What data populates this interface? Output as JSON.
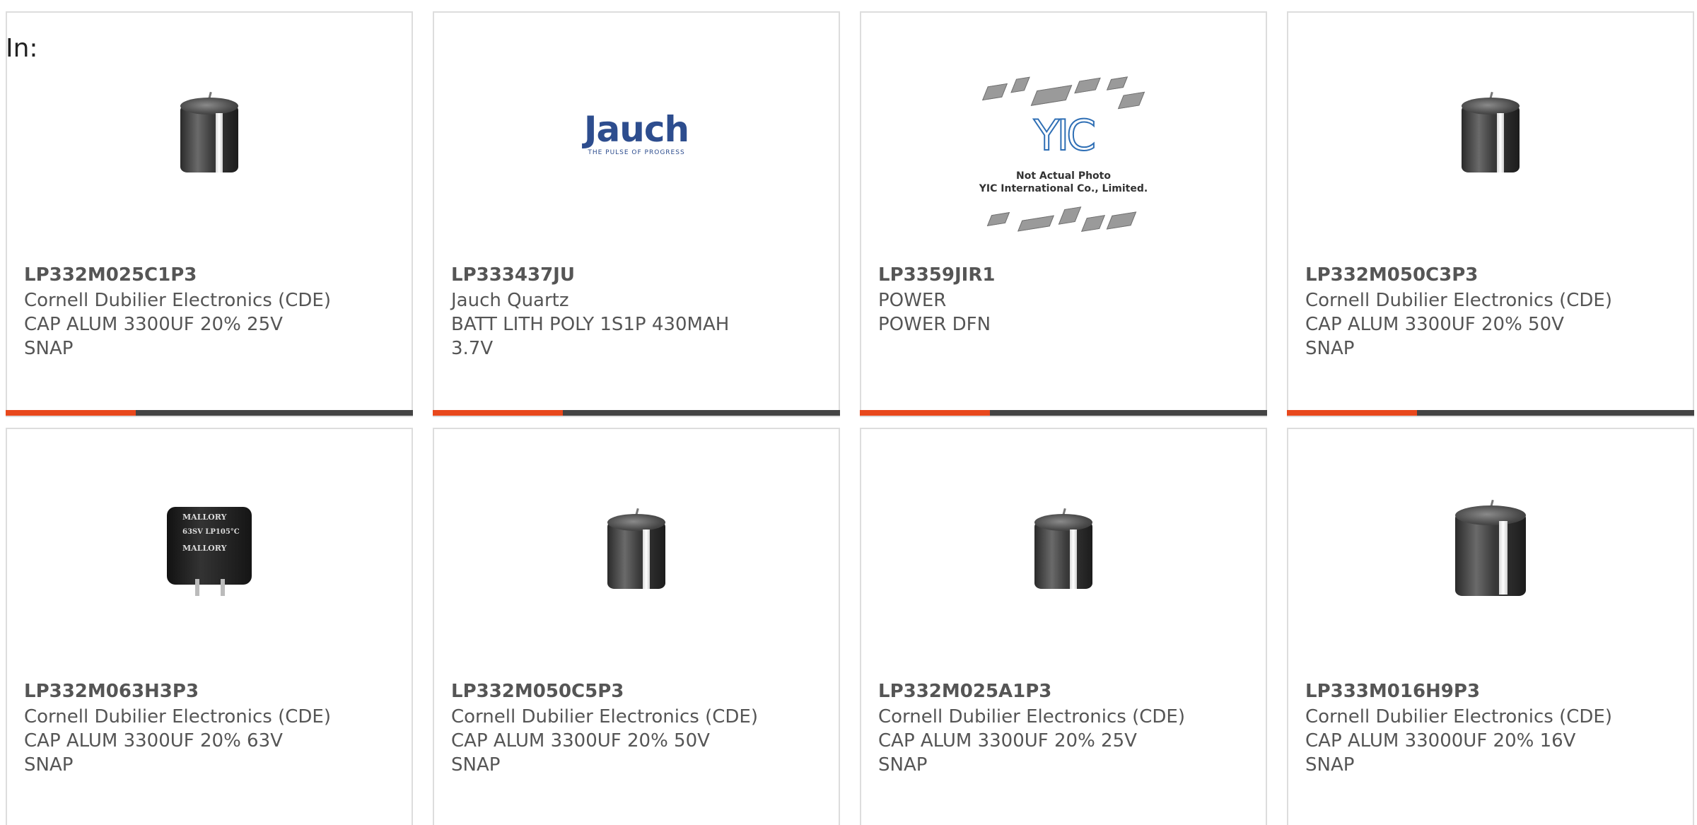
{
  "filter": {
    "label": "In:"
  },
  "products": [
    {
      "part": "LP332M025C1P3",
      "manufacturer": "Cornell Dubilier Electronics (CDE)",
      "description": "CAP ALUM 3300UF 20% 25V\nSNAP",
      "image": "capacitor-image",
      "progress": 0.32
    },
    {
      "part": "LP333437JU",
      "manufacturer": "Jauch Quartz",
      "description": "BATT LITH POLY 1S1P 430MAH\n3.7V",
      "image": "jauch-logo",
      "logo_text": "Jauch",
      "logo_tagline": "THE PULSE OF PROGRESS",
      "progress": 0.32
    },
    {
      "part": "LP3359JIR1",
      "manufacturer": "POWER",
      "description": "POWER DFN",
      "image": "yic-placeholder",
      "logo_text": "YIC",
      "caption_line1": "Not Actual Photo",
      "caption_line2": "YIC International Co., Limited.",
      "progress": 0.32
    },
    {
      "part": "LP332M050C3P3",
      "manufacturer": "Cornell Dubilier Electronics (CDE)",
      "description": "CAP ALUM 3300UF 20% 50V\nSNAP",
      "image": "capacitor-image",
      "progress": 0.32
    },
    {
      "part": "LP332M063H3P3",
      "manufacturer": "Cornell Dubilier Electronics (CDE)",
      "description": "CAP ALUM 3300UF 20% 63V\nSNAP",
      "image": "mallory-capacitor-image",
      "logo_text": "MALLORY",
      "rating_text": "63SV LP105°C"
    },
    {
      "part": "LP332M050C5P3",
      "manufacturer": "Cornell Dubilier Electronics (CDE)",
      "description": "CAP ALUM 3300UF 20% 50V\nSNAP",
      "image": "capacitor-image"
    },
    {
      "part": "LP332M025A1P3",
      "manufacturer": "Cornell Dubilier Electronics (CDE)",
      "description": "CAP ALUM 3300UF 20% 25V\nSNAP",
      "image": "capacitor-image"
    },
    {
      "part": "LP333M016H9P3",
      "manufacturer": "Cornell Dubilier Electronics (CDE)",
      "description": "CAP ALUM 33000UF 20% 16V\nSNAP",
      "image": "capacitor-image"
    }
  ],
  "colors": {
    "accent": "#e8481c",
    "bar_track": "#444444",
    "text": "#555555",
    "border": "#dddddd"
  }
}
